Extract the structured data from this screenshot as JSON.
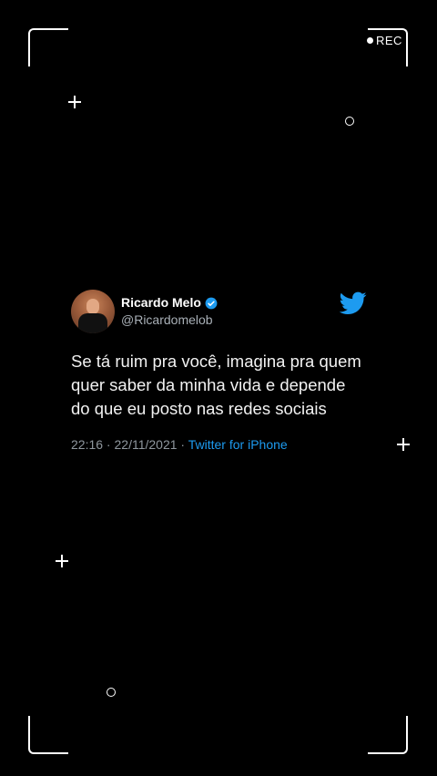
{
  "overlay": {
    "rec_label": "REC"
  },
  "tweet": {
    "author_name": "Ricardo Melo",
    "handle": "@Ricardomelob",
    "verified": true,
    "text": "Se tá ruim pra você, imagina pra quem quer saber da minha vida e depende do que eu posto nas redes sociais",
    "time": "22:16",
    "separator": " · ",
    "date": "22/11/2021",
    "source": "Twitter for iPhone"
  },
  "colors": {
    "background": "#000000",
    "link_blue": "#1d9bf0",
    "secondary_text": "#8f979e"
  },
  "icons": [
    "verified-badge-icon",
    "twitter-bird-icon"
  ]
}
